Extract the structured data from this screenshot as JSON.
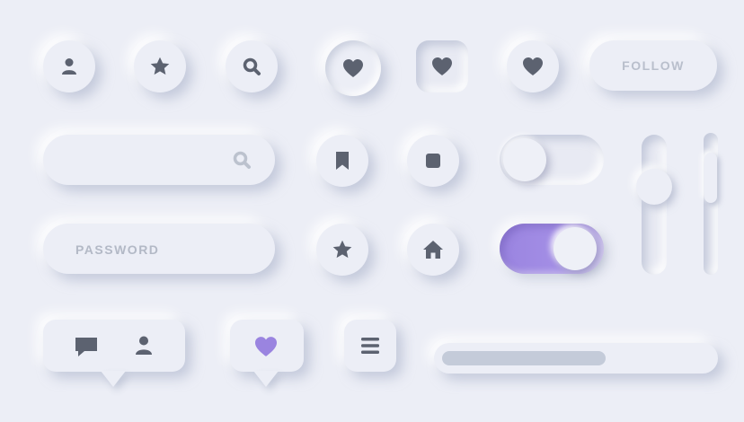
{
  "colors": {
    "background": "#eceef6",
    "icon": "#5c6270",
    "accent": "#9a84e0",
    "heart_accent": "#9a84e0",
    "placeholder": "#b3b9c6"
  },
  "buttons": {
    "follow_label": "FOLLOW"
  },
  "search": {
    "placeholder": "",
    "icon": "search-icon"
  },
  "password": {
    "placeholder": "PASSWORD"
  },
  "icons": {
    "row1": [
      "user-icon",
      "star-icon",
      "search-icon",
      "heart-icon",
      "heart-icon",
      "heart-icon"
    ],
    "row2": [
      "bookmark-icon",
      "stop-icon"
    ],
    "row3": [
      "star-icon",
      "home-icon"
    ],
    "row4": [
      "chat-icon",
      "user-icon",
      "heart-icon",
      "menu-icon"
    ]
  },
  "toggles": [
    {
      "state": "off"
    },
    {
      "state": "on"
    }
  ],
  "sliders": [
    {
      "orientation": "vertical",
      "level": 0.75
    },
    {
      "orientation": "vertical",
      "level": 0.8
    }
  ],
  "progress": {
    "value": 0.61
  }
}
